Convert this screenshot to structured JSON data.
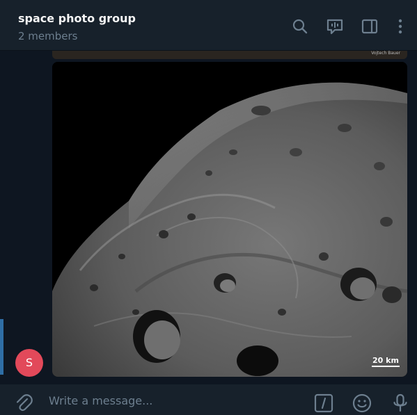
{
  "header": {
    "title": "space photo group",
    "subtitle": "2 members",
    "icons": [
      "search-icon",
      "live-stream-icon",
      "sidebar-toggle-icon",
      "more-icon"
    ]
  },
  "messages": {
    "previous_photo_credit": "Vojtech Bauer",
    "photo_scale_label": "20 km",
    "sender_avatar_letter": "S"
  },
  "composer": {
    "placeholder": "Write a message...",
    "icons": [
      "attach-icon",
      "bot-commands-icon",
      "emoji-icon",
      "microphone-icon"
    ]
  },
  "colors": {
    "header_bg": "#17212b",
    "chat_bg": "#0e1621",
    "avatar_bg": "#e2495a",
    "icon": "#6d7f8f",
    "selection_bar": "#2f6ea5"
  }
}
